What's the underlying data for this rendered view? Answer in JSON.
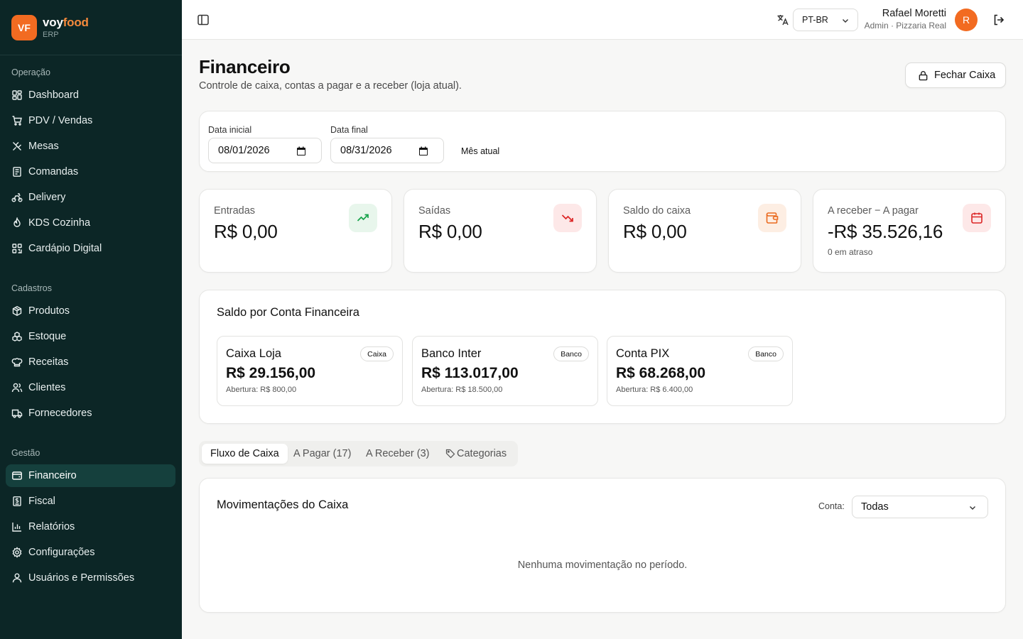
{
  "brand": {
    "badge": "VF",
    "name_a": "voy",
    "name_b": "food",
    "sub": "ERP"
  },
  "sidebar": {
    "sections": [
      "Operação",
      "Cadastros",
      "Gestão"
    ],
    "operacao": [
      "Dashboard",
      "PDV / Vendas",
      "Mesas",
      "Comandas",
      "Delivery",
      "KDS Cozinha",
      "Cardápio Digital"
    ],
    "cadastros": [
      "Produtos",
      "Estoque",
      "Receitas",
      "Clientes",
      "Fornecedores"
    ],
    "gestao": [
      "Financeiro",
      "Fiscal",
      "Relatórios",
      "Configurações",
      "Usuários e Permissões"
    ],
    "active": "Financeiro"
  },
  "topbar": {
    "language": "PT-BR",
    "user_name": "Rafael Moretti",
    "user_role": "Admin · Pizzaria Real",
    "avatar": "R"
  },
  "header": {
    "title": "Financeiro",
    "subtitle": "Controle de caixa, contas a pagar e a receber (loja atual).",
    "close_button": "Fechar Caixa"
  },
  "filters": {
    "start_label": "Data inicial",
    "start_value": "08/01/2026",
    "end_label": "Data final",
    "end_value": "08/31/2026",
    "current_month": "Mês atual"
  },
  "stats": [
    {
      "label": "Entradas",
      "value": "R$ 0,00",
      "icon": "trending-up-icon",
      "color": "#16a34a",
      "bg": "#e8f6ec"
    },
    {
      "label": "Saídas",
      "value": "R$ 0,00",
      "icon": "trending-down-icon",
      "color": "#dc2626",
      "bg": "#fde8e8"
    },
    {
      "label": "Saldo do caixa",
      "value": "R$ 0,00",
      "icon": "wallet-icon",
      "color": "#ea6a1f",
      "bg": "#fdeee3"
    },
    {
      "label": "A receber − A pagar",
      "value": "-R$ 35.526,16",
      "note": "0 em atraso",
      "icon": "calendar-icon",
      "color": "#dc2626",
      "bg": "#fde8e8"
    }
  ],
  "accounts": {
    "title": "Saldo por Conta Financeira",
    "items": [
      {
        "name": "Caixa Loja",
        "type": "Caixa",
        "value": "R$ 29.156,00",
        "opening": "Abertura: R$ 800,00"
      },
      {
        "name": "Banco Inter",
        "type": "Banco",
        "value": "R$ 113.017,00",
        "opening": "Abertura: R$ 18.500,00"
      },
      {
        "name": "Conta PIX",
        "type": "Banco",
        "value": "R$ 68.268,00",
        "opening": "Abertura: R$ 6.400,00"
      }
    ]
  },
  "tabs": [
    "Fluxo de Caixa",
    "A Pagar (17)",
    "A Receber (3)",
    "Categorias"
  ],
  "movements": {
    "title": "Movimentações do Caixa",
    "account_label": "Conta:",
    "account_value": "Todas",
    "empty": "Nenhuma movimentação no período."
  }
}
